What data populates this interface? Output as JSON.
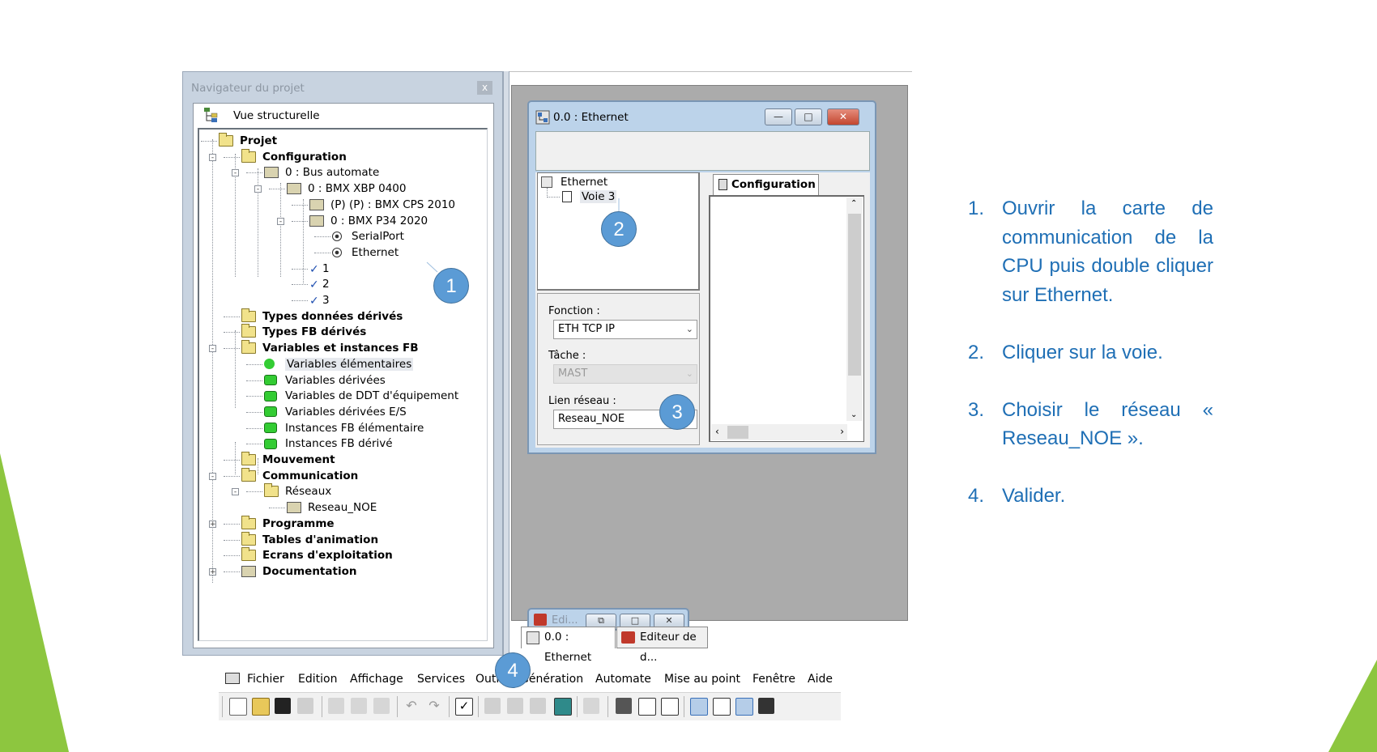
{
  "navigator": {
    "title": "Navigateur du projet",
    "close_glyph": "x",
    "view_label": "Vue structurelle",
    "tree": [
      {
        "label": "Projet",
        "bold": true,
        "icon": "folder-open-icon"
      },
      {
        "label": "Configuration",
        "bold": true,
        "icon": "folder-open-icon"
      },
      {
        "label": "0 : Bus automate",
        "bold": false,
        "icon": "bus-icon"
      },
      {
        "label": "0 : BMX XBP 0400",
        "bold": false,
        "icon": "rack-icon"
      },
      {
        "label": "(P) (P) : BMX CPS 2010",
        "bold": false,
        "icon": "module-icon"
      },
      {
        "label": "0 : BMX P34 2020",
        "bold": false,
        "icon": "cpu-icon"
      },
      {
        "label": "SerialPort",
        "bold": false,
        "icon": "port-icon"
      },
      {
        "label": "Ethernet",
        "bold": false,
        "icon": "port-icon"
      },
      {
        "label": "1",
        "bold": false,
        "icon": "slot-icon"
      },
      {
        "label": "2",
        "bold": false,
        "icon": "slot-icon"
      },
      {
        "label": "3",
        "bold": false,
        "icon": "slot-icon"
      },
      {
        "label": "Types données dérivés",
        "bold": true,
        "icon": "folder-icon"
      },
      {
        "label": "Types FB dérivés",
        "bold": true,
        "icon": "folder-icon"
      },
      {
        "label": "Variables et instances FB",
        "bold": true,
        "icon": "folder-open-icon"
      },
      {
        "label": "Variables élémentaires",
        "bold": false,
        "icon": "green-dot-icon"
      },
      {
        "label": "Variables dérivées",
        "bold": false,
        "icon": "green-box-icon"
      },
      {
        "label": "Variables de DDT d'équipement",
        "bold": false,
        "icon": "green-box-icon"
      },
      {
        "label": "Variables dérivées E/S",
        "bold": false,
        "icon": "green-box-icon"
      },
      {
        "label": "Instances FB élémentaire",
        "bold": false,
        "icon": "green-box-icon"
      },
      {
        "label": "Instances FB dérivé",
        "bold": false,
        "icon": "green-box-icon"
      },
      {
        "label": "Mouvement",
        "bold": true,
        "icon": "folder-icon"
      },
      {
        "label": "Communication",
        "bold": true,
        "icon": "folder-open-icon"
      },
      {
        "label": "Réseaux",
        "bold": false,
        "icon": "folder-open-icon"
      },
      {
        "label": "Reseau_NOE",
        "bold": false,
        "icon": "network-icon"
      },
      {
        "label": "Programme",
        "bold": true,
        "icon": "folder-icon"
      },
      {
        "label": "Tables d'animation",
        "bold": true,
        "icon": "folder-icon"
      },
      {
        "label": "Ecrans d'exploitation",
        "bold": true,
        "icon": "folder-icon"
      },
      {
        "label": "Documentation",
        "bold": true,
        "icon": "documentation-icon"
      }
    ]
  },
  "ethernet_window": {
    "title": "0.0 : Ethernet",
    "tree_root": "Ethernet",
    "tree_child": "Voie 3",
    "fonction_label": "Fonction :",
    "fonction_value": "ETH TCP IP",
    "tache_label": "Tâche :",
    "tache_value": "MAST",
    "lien_label": "Lien réseau :",
    "lien_value": "Reseau_NOE",
    "config_tab": "Configuration"
  },
  "minimized_window": {
    "title": "Edi..."
  },
  "bottom_tabs": [
    {
      "label": "0.0 : Ethernet"
    },
    {
      "label": "Editeur de d..."
    }
  ],
  "menubar": [
    "Fichier",
    "Edition",
    "Affichage",
    "Services",
    "Outils",
    "Génération",
    "Automate",
    "Mise au point",
    "Fenêtre",
    "Aide"
  ],
  "callouts": [
    "1",
    "2",
    "3",
    "4"
  ],
  "instructions": [
    {
      "num": "1.",
      "text": "Ouvrir la carte de communication de la CPU puis double cliquer sur Ethernet."
    },
    {
      "num": "2.",
      "text": "Cliquer sur la voie."
    },
    {
      "num": "3.",
      "text": "Choisir le réseau « Reseau_NOE »."
    },
    {
      "num": "4.",
      "text": "Valider."
    }
  ],
  "colors": {
    "callout": "#5b9bd5",
    "instruction_text": "#1f6fb5",
    "accent_green": "#92d050"
  }
}
